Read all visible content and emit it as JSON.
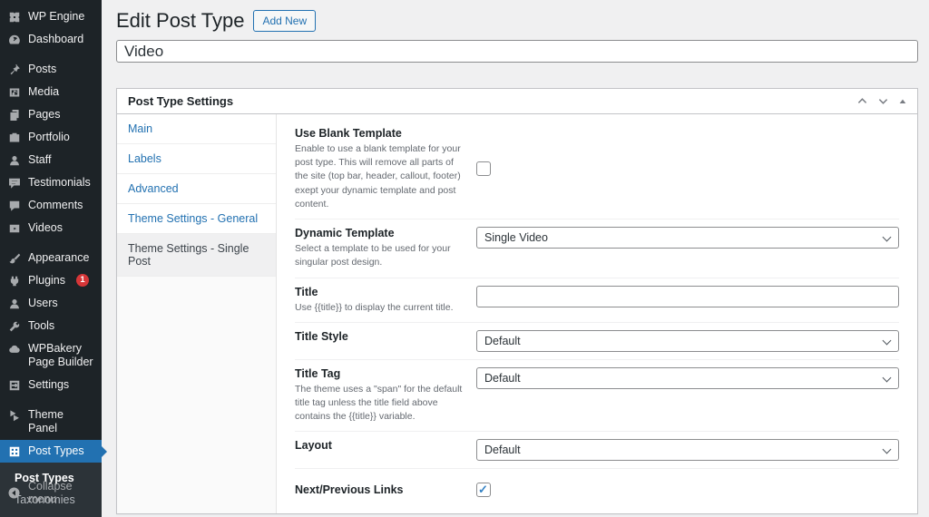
{
  "colors": {
    "accent": "#2271b1",
    "badge_red": "#d63638",
    "sidebar_bg": "#1d2327",
    "submenu_bg": "#2c3338",
    "content_bg": "#f0f0f1",
    "panel_border": "#c3c4c7"
  },
  "sidebar": {
    "items": [
      {
        "label": "WP Engine"
      },
      {
        "label": "Dashboard"
      },
      {
        "label": "Posts"
      },
      {
        "label": "Media"
      },
      {
        "label": "Pages"
      },
      {
        "label": "Portfolio"
      },
      {
        "label": "Staff"
      },
      {
        "label": "Testimonials"
      },
      {
        "label": "Comments"
      },
      {
        "label": "Videos"
      },
      {
        "label": "Appearance"
      },
      {
        "label": "Plugins",
        "badge": "1"
      },
      {
        "label": "Users"
      },
      {
        "label": "Tools"
      },
      {
        "label": "WPBakery Page Builder"
      },
      {
        "label": "Settings"
      },
      {
        "label": "Theme Panel"
      },
      {
        "label": "Post Types"
      }
    ],
    "submenu": {
      "items": [
        {
          "label": "Post Types"
        },
        {
          "label": "Taxonomies"
        }
      ]
    },
    "collapse_label": "Collapse menu"
  },
  "header": {
    "title": "Edit Post Type",
    "add_new_label": "Add New"
  },
  "post_title": {
    "value": "Video"
  },
  "panel": {
    "title": "Post Type Settings",
    "tabs": [
      {
        "label": "Main"
      },
      {
        "label": "Labels"
      },
      {
        "label": "Advanced"
      },
      {
        "label": "Theme Settings - General"
      },
      {
        "label": "Theme Settings - Single Post"
      }
    ],
    "active_tab": "Theme Settings - Single Post",
    "fields": {
      "blank_template": {
        "label": "Use Blank Template",
        "description": "Enable to use a blank template for your post type. This will remove all parts of the site (top bar, header, callout, footer) exept your dynamic template and post content.",
        "checked": false
      },
      "dynamic_template": {
        "label": "Dynamic Template",
        "description": "Select a template to be used for your singular post design.",
        "value": "Single Video"
      },
      "title": {
        "label": "Title",
        "description": "Use {{title}} to display the current title.",
        "value": ""
      },
      "title_style": {
        "label": "Title Style",
        "value": "Default"
      },
      "title_tag": {
        "label": "Title Tag",
        "description": "The theme uses a \"span\" for the default title tag unless the title field above contains the {{title}} variable.",
        "value": "Default"
      },
      "layout": {
        "label": "Layout",
        "value": "Default"
      },
      "next_previous": {
        "label": "Next/Previous Links",
        "checked": true
      }
    }
  }
}
